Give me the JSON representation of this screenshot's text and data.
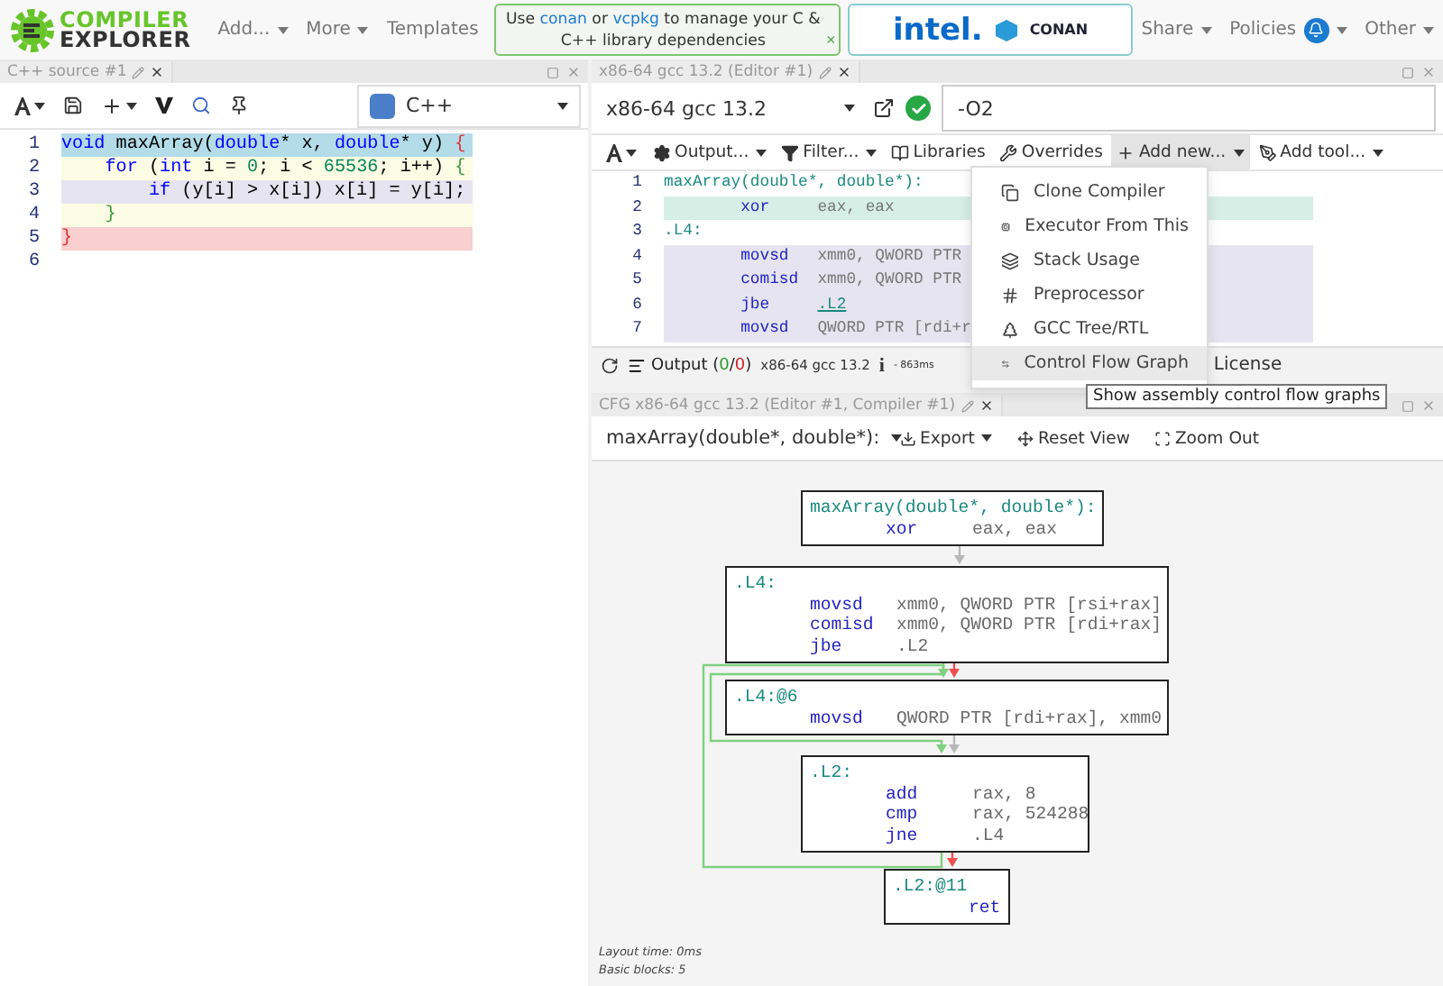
{
  "header": {
    "logo": [
      "COMPILER",
      "EXPLORER"
    ],
    "nav_left": [
      "Add...",
      "More"
    ],
    "templates": "Templates",
    "banner": {
      "parts": [
        {
          "text": "Use "
        },
        {
          "text": "conan",
          "link": true
        },
        {
          "text": " or "
        },
        {
          "text": "vcpkg",
          "link": true
        },
        {
          "text": " to manage your C & C++ library dependencies"
        }
      ],
      "close": "×"
    },
    "sponsor": {
      "brand": "intel.",
      "partner": "CONAN"
    },
    "nav_right": [
      {
        "label": "Share",
        "badge": false
      },
      {
        "label": "Policies",
        "badge": true
      },
      {
        "label": "Other",
        "badge": false
      }
    ]
  },
  "source_pane": {
    "tab": "C++ source #1",
    "language": "C++",
    "lines": [
      {
        "number": "1",
        "color": "#b3dbe8",
        "tokens": [
          {
            "kind": "keyword",
            "text": "void"
          },
          {
            "kind": "plain",
            "text": " maxArray("
          },
          {
            "kind": "keyword",
            "text": "double"
          },
          {
            "kind": "plain",
            "text": "* x, "
          },
          {
            "kind": "keyword",
            "text": "double"
          },
          {
            "kind": "plain",
            "text": "* y) "
          },
          {
            "kind": "brace",
            "text": "{"
          }
        ]
      },
      {
        "number": "2",
        "color": "#fcfce4",
        "tokens": [
          {
            "kind": "keyword",
            "text": "    for"
          },
          {
            "kind": "plain",
            "text": " ("
          },
          {
            "kind": "keyword",
            "text": "int"
          },
          {
            "kind": "plain",
            "text": " i = "
          },
          {
            "kind": "number",
            "text": "0"
          },
          {
            "kind": "plain",
            "text": "; i < "
          },
          {
            "kind": "number",
            "text": "65536"
          },
          {
            "kind": "plain",
            "text": "; i++) "
          },
          {
            "kind": "inner_brace",
            "text": "{"
          }
        ]
      },
      {
        "number": "3",
        "color": "#e6e4f0",
        "tokens": [
          {
            "kind": "keyword",
            "text": "        if"
          },
          {
            "kind": "plain",
            "text": " (y[i] > x[i]) x[i] = y[i];"
          }
        ]
      },
      {
        "number": "4",
        "color": "#fcfce4",
        "tokens": [
          {
            "kind": "inner_brace",
            "text": "    }"
          }
        ]
      },
      {
        "number": "5",
        "color": "#f9cfcf",
        "tokens": [
          {
            "kind": "brace",
            "text": "}"
          }
        ]
      },
      {
        "number": "6"
      }
    ]
  },
  "compiler_pane": {
    "tab": "x86-64 gcc 13.2 (Editor #1)",
    "compiler": "x86-64 gcc 13.2",
    "options": "-O2",
    "toolbar": [
      {
        "label": "Output...",
        "kind": "gear",
        "selected": false
      },
      {
        "label": "Filter...",
        "kind": "filter",
        "selected": false
      },
      {
        "label": "Libraries",
        "kind": "book",
        "selected": false
      },
      {
        "label": "Overrides",
        "kind": "wrench",
        "selected": false
      },
      {
        "label": "Add new...",
        "kind": "plus",
        "selected": true
      },
      {
        "label": "Add tool...",
        "kind": "pen",
        "selected": false
      }
    ],
    "asm": [
      {
        "number": "1",
        "kind": "label",
        "text": "maxArray(double*, double*):",
        "color": "#ffffff"
      },
      {
        "number": "2",
        "kind": "instr",
        "op": "xor",
        "args": "eax, eax",
        "color": "#d5efe6"
      },
      {
        "number": "3",
        "kind": "label",
        "text": ".L4:",
        "color": "#ffffff"
      },
      {
        "number": "4",
        "kind": "instr",
        "op": "movsd",
        "args": "xmm0, QWORD PTR",
        "color": "#e6e4f0"
      },
      {
        "number": "5",
        "kind": "instr",
        "op": "comisd",
        "args": "xmm0, QWORD PTR",
        "color": "#e6e4f0"
      },
      {
        "number": "6",
        "kind": "jump",
        "op": "jbe",
        "args": ".L2",
        "color": "#e6e4f0"
      },
      {
        "number": "7",
        "kind": "instr",
        "op": "movsd",
        "args": "QWORD PTR [rdi+r",
        "color": "#e6e4f0"
      }
    ],
    "output": {
      "parts": [
        {
          "text": "Output (",
          "kind": "text"
        },
        {
          "text": "0",
          "kind": "ok"
        },
        {
          "text": "/",
          "kind": "text"
        },
        {
          "text": "0",
          "kind": "error"
        },
        {
          "text": ")",
          "kind": "text"
        }
      ],
      "compiler": "x86-64 gcc 13.2",
      "info": "i",
      "timing": "- 863ms",
      "license": "License"
    },
    "menu": [
      {
        "label": "Clone Compiler",
        "kind": "clone",
        "selected": false
      },
      {
        "label": "Executor From This",
        "kind": "chip",
        "selected": false
      },
      {
        "label": "Stack Usage",
        "kind": "layers",
        "selected": false
      },
      {
        "label": "Preprocessor",
        "kind": "hash",
        "selected": false
      },
      {
        "label": "GCC Tree/RTL",
        "kind": "tree",
        "selected": false
      },
      {
        "label": "Control Flow Graph",
        "kind": "flow",
        "selected": true
      }
    ],
    "tooltip": "Show assembly control flow graphs"
  },
  "cfg_pane": {
    "tab": "CFG x86-64 gcc 13.2 (Editor #1, Compiler #1)",
    "function": "maxArray(double*, double*):",
    "actions": [
      {
        "label": "Export",
        "kind": "export"
      },
      {
        "label": "Reset View",
        "kind": "reset"
      },
      {
        "label": "Zoom Out",
        "kind": "zoom"
      }
    ],
    "nodes": [
      {
        "lines": [
          {
            "kind": "label",
            "text": "maxArray(double*, double*):"
          },
          {
            "kind": "instr",
            "op": "xor",
            "args": "eax, eax"
          }
        ],
        "out": [
          {
            "kind": "next",
            "color": "#b8b8b8"
          }
        ]
      },
      {
        "lines": [
          {
            "kind": "label",
            "text": ".L4:"
          },
          {
            "kind": "instr",
            "op": "movsd",
            "args": "xmm0, QWORD PTR [rsi+rax]"
          },
          {
            "kind": "instr",
            "op": "comisd",
            "args": "xmm0, QWORD PTR [rdi+rax]"
          },
          {
            "kind": "instr",
            "op": "jbe",
            "args": ".L2"
          }
        ],
        "out": [
          {
            "kind": "next",
            "color": "#f05050"
          },
          {
            "kind": "skip",
            "color": "#7fd07f"
          }
        ]
      },
      {
        "lines": [
          {
            "kind": "label",
            "text": ".L4:@6"
          },
          {
            "kind": "instr",
            "op": "movsd",
            "args": "QWORD PTR [rdi+rax], xmm0"
          }
        ],
        "out": [
          {
            "kind": "next",
            "color": "#b8b8b8"
          }
        ]
      },
      {
        "lines": [
          {
            "kind": "label",
            "text": ".L2:"
          },
          {
            "kind": "instr",
            "op": "add",
            "args": "rax, 8"
          },
          {
            "kind": "instr",
            "op": "cmp",
            "args": "rax, 524288"
          },
          {
            "kind": "instr",
            "op": "jne",
            "args": ".L4"
          }
        ],
        "out": [
          {
            "kind": "next",
            "color": "#f05050"
          },
          {
            "kind": "back",
            "color": "#7fd07f"
          }
        ]
      },
      {
        "lines": [
          {
            "kind": "label",
            "text": ".L2:@11"
          },
          {
            "kind": "instr",
            "op": "ret"
          }
        ]
      }
    ],
    "footer": [
      "Layout time: 0ms",
      "Basic blocks: 5"
    ]
  }
}
